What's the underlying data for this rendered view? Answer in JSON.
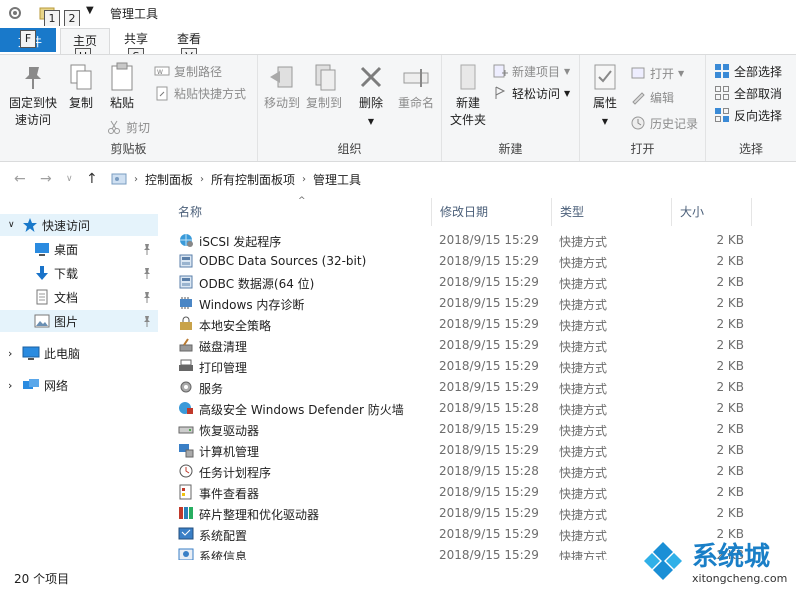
{
  "window": {
    "title": "管理工具",
    "keytips": {
      "qa1": "1",
      "qa2": "2",
      "file": "F",
      "home": "H",
      "share": "S",
      "view": "V"
    }
  },
  "tabs": {
    "file": "文件",
    "home": "主页",
    "share": "共享",
    "view": "查看"
  },
  "ribbon": {
    "clipboard": {
      "group_label": "剪贴板",
      "pin_line1": "固定到快",
      "pin_line2": "速访问",
      "copy": "复制",
      "paste": "粘贴",
      "copy_path": "复制路径",
      "paste_shortcut": "粘贴快捷方式",
      "cut": "剪切"
    },
    "organize": {
      "group_label": "组织",
      "move_to": "移动到",
      "copy_to": "复制到",
      "delete": "删除",
      "rename": "重命名"
    },
    "new": {
      "group_label": "新建",
      "new_folder_line1": "新建",
      "new_folder_line2": "文件夹",
      "new_item": "新建项目",
      "easy_access": "轻松访问"
    },
    "open": {
      "group_label": "打开",
      "properties": "属性",
      "open": "打开",
      "edit": "编辑",
      "history": "历史记录"
    },
    "select": {
      "group_label": "选择",
      "select_all": "全部选择",
      "select_none": "全部取消",
      "invert": "反向选择"
    }
  },
  "breadcrumb": [
    "控制面板",
    "所有控制面板项",
    "管理工具"
  ],
  "nav": {
    "quick_access": "快速访问",
    "desktop": "桌面",
    "downloads": "下载",
    "documents": "文档",
    "pictures": "图片",
    "this_pc": "此电脑",
    "network": "网络"
  },
  "columns": {
    "name": "名称",
    "date": "修改日期",
    "type": "类型",
    "size": "大小"
  },
  "files": [
    {
      "name": "iSCSI 发起程序",
      "date": "2018/9/15 15:29",
      "type": "快捷方式",
      "size": "2 KB",
      "icon": "globe-gear-icon"
    },
    {
      "name": "ODBC Data Sources (32-bit)",
      "date": "2018/9/15 15:29",
      "type": "快捷方式",
      "size": "2 KB",
      "icon": "database-icon"
    },
    {
      "name": "ODBC 数据源(64 位)",
      "date": "2018/9/15 15:29",
      "type": "快捷方式",
      "size": "2 KB",
      "icon": "database-icon"
    },
    {
      "name": "Windows 内存诊断",
      "date": "2018/9/15 15:29",
      "type": "快捷方式",
      "size": "2 KB",
      "icon": "memory-chip-icon"
    },
    {
      "name": "本地安全策略",
      "date": "2018/9/15 15:29",
      "type": "快捷方式",
      "size": "2 KB",
      "icon": "security-policy-icon"
    },
    {
      "name": "磁盘清理",
      "date": "2018/9/15 15:29",
      "type": "快捷方式",
      "size": "2 KB",
      "icon": "disk-cleanup-icon"
    },
    {
      "name": "打印管理",
      "date": "2018/9/15 15:29",
      "type": "快捷方式",
      "size": "2 KB",
      "icon": "printer-icon"
    },
    {
      "name": "服务",
      "date": "2018/9/15 15:29",
      "type": "快捷方式",
      "size": "2 KB",
      "icon": "gear-icon"
    },
    {
      "name": "高级安全 Windows Defender 防火墙",
      "date": "2018/9/15 15:28",
      "type": "快捷方式",
      "size": "2 KB",
      "icon": "firewall-icon"
    },
    {
      "name": "恢复驱动器",
      "date": "2018/9/15 15:29",
      "type": "快捷方式",
      "size": "2 KB",
      "icon": "drive-icon"
    },
    {
      "name": "计算机管理",
      "date": "2018/9/15 15:29",
      "type": "快捷方式",
      "size": "2 KB",
      "icon": "computer-management-icon"
    },
    {
      "name": "任务计划程序",
      "date": "2018/9/15 15:28",
      "type": "快捷方式",
      "size": "2 KB",
      "icon": "clock-icon"
    },
    {
      "name": "事件查看器",
      "date": "2018/9/15 15:29",
      "type": "快捷方式",
      "size": "2 KB",
      "icon": "event-viewer-icon"
    },
    {
      "name": "碎片整理和优化驱动器",
      "date": "2018/9/15 15:29",
      "type": "快捷方式",
      "size": "2 KB",
      "icon": "defrag-icon"
    },
    {
      "name": "系统配置",
      "date": "2018/9/15 15:29",
      "type": "快捷方式",
      "size": "2 KB",
      "icon": "system-config-icon"
    },
    {
      "name": "系统信息",
      "date": "2018/9/15 15:29",
      "type": "快捷方式",
      "size": "2 KB",
      "icon": "system-info-icon"
    }
  ],
  "status": {
    "item_count": "20 个项目"
  },
  "watermark": {
    "brand": "系统城",
    "domain": "xitongcheng.com"
  },
  "colors": {
    "accent": "#1979ca",
    "selection": "#e5f3fb",
    "muted_text": "#6d6d6d"
  }
}
